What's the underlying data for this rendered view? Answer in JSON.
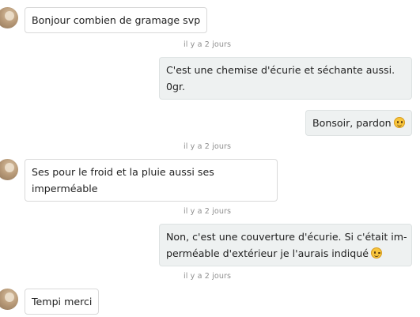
{
  "messages": [
    {
      "direction": "in",
      "lines": [
        "Bonjour combien de gramage svp"
      ]
    },
    {
      "direction": "out",
      "lines": [
        "C'est une chemise d'écurie et séchante aussi.",
        "0gr."
      ]
    },
    {
      "direction": "out",
      "lines": [
        "Bonsoir, pardon"
      ],
      "emoji": "grinning-sweat-emoji"
    },
    {
      "direction": "in",
      "lines": [
        "Ses pour le froid et la pluie aussi ses",
        "imperméable"
      ]
    },
    {
      "direction": "out",
      "lines": [
        "Non, c'est une couverture d'écurie. Si c'était im-",
        "perméable d'extérieur je l'aurais indiqué"
      ],
      "emoji": "winking-face-emoji"
    },
    {
      "direction": "in",
      "lines": [
        "Tempi merci"
      ]
    }
  ],
  "timestamps": [
    "il y a 2 jours",
    "il y a 2 jours",
    "il y a 2 jours",
    "il y a 2 jours"
  ],
  "colors": {
    "incoming_bubble": "#ffffff",
    "outgoing_bubble": "#eef1f1",
    "timestamp_text": "#8f8f8f",
    "emoji_yellow": "#f7c53c"
  }
}
